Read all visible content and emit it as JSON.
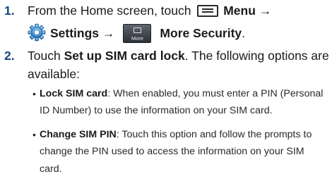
{
  "step1": {
    "number": "1.",
    "line1_prefix": "From the Home screen, touch",
    "menu_label": "Menu",
    "arrow": "→",
    "settings_label": "Settings",
    "more_icon_caption": "More",
    "more_security_label": "More Security",
    "period": "."
  },
  "step2": {
    "number": "2.",
    "touch_word": "Touch",
    "setup_label": "Set up SIM card lock",
    "line1_suffix": ". The following options are",
    "line2": "available:"
  },
  "bullets": [
    {
      "term": "Lock SIM card",
      "line1": ": When enabled, you must enter a PIN (Personal",
      "line2": "ID Number) to use the information on your SIM card."
    },
    {
      "term": "Change SIM PIN",
      "line1": ": Touch this option and follow the prompts to",
      "line2": "change the PIN used to access the information on your SIM",
      "line3": "card."
    }
  ],
  "icons": {
    "menu": "menu-icon",
    "settings": "gear-icon",
    "more": "more-icon"
  }
}
